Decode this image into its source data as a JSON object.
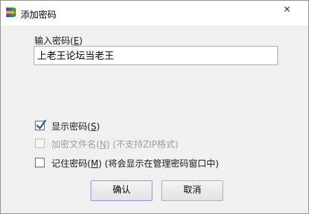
{
  "window": {
    "title": "添加密码",
    "close_glyph": "✕",
    "icon": "winrar-archive-icon"
  },
  "password": {
    "label_prefix": "输入密码(",
    "label_key": "E",
    "label_suffix": ")",
    "value": "上老王论坛当老王"
  },
  "options": [
    {
      "prefix": "显示密码(",
      "key": "S",
      "suffix": ")",
      "checked": true,
      "enabled": true
    },
    {
      "prefix": "加密文件名(",
      "key": "N",
      "suffix": ") (不支持ZIP格式)",
      "checked": false,
      "enabled": false
    },
    {
      "prefix": "记住密码(",
      "key": "M",
      "suffix": ") (将会显示在管理密码窗口中)",
      "checked": false,
      "enabled": true
    }
  ],
  "buttons": {
    "ok": "确认",
    "cancel": "取消"
  },
  "colors": {
    "checkmark": "#2a5dac",
    "title_bg": "#ffffff",
    "client_bg": "#f0f0f0"
  }
}
